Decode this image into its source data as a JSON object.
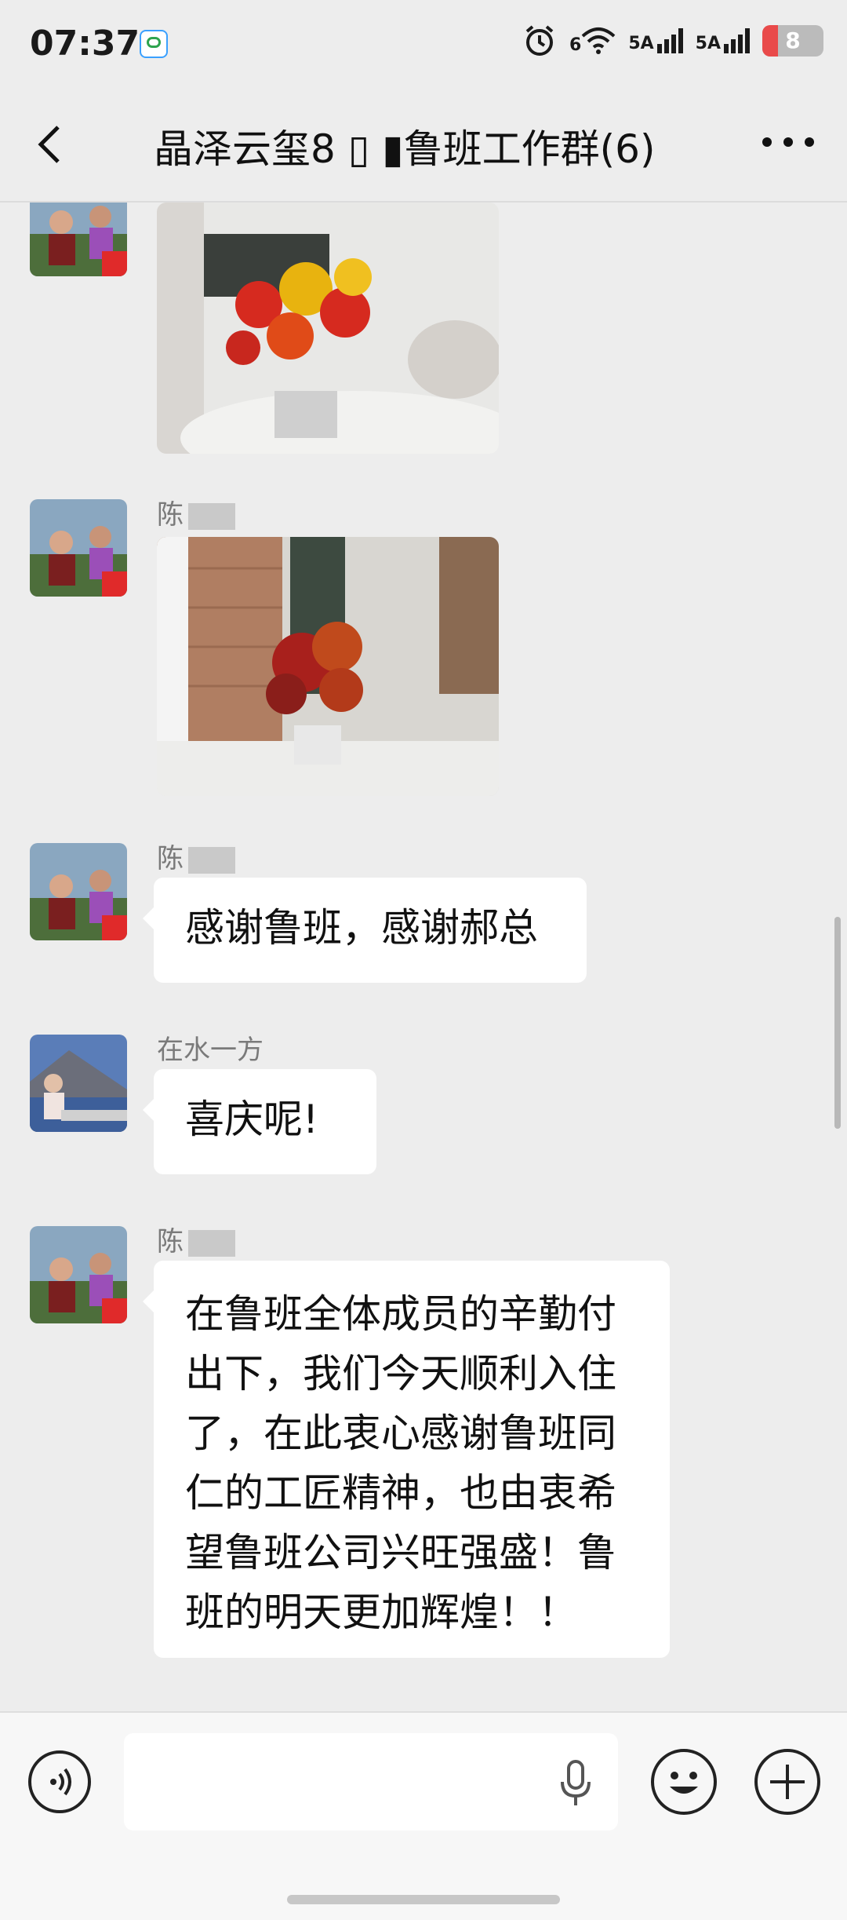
{
  "status_bar": {
    "time": "07:37",
    "signal1": "6",
    "signal2": "5A",
    "signal3": "5A",
    "battery": "8",
    "icons": [
      "app-notification-icon",
      "alarm-icon",
      "wifi-icon",
      "signal-icon",
      "signal-icon",
      "battery-icon"
    ]
  },
  "header": {
    "title": "晶泽云玺8 ▯ ▮鲁班工作群(6)",
    "back_icon": "chevron-left-icon",
    "more_icon": "more-dots-icon"
  },
  "messages": [
    {
      "type": "image",
      "sender": "",
      "image_desc_icon": "photo-flowers-vase-icon"
    },
    {
      "type": "image",
      "sender": "陈",
      "image_desc_icon": "photo-flowers-window-icon"
    },
    {
      "type": "text",
      "sender": "陈",
      "text": "感谢鲁班，感谢郝总"
    },
    {
      "type": "text",
      "sender": "在水一方",
      "text": "喜庆呢!"
    },
    {
      "type": "text",
      "sender": "陈",
      "text": "在鲁班全体成员的辛勤付出下，我们今天顺利入住了，在此衷心感谢鲁班同仁的工匠精神，也由衷希望鲁班公司兴旺强盛！鲁班的明天更加辉煌！！"
    }
  ],
  "input_bar": {
    "voice_icon": "voice-mode-icon",
    "mic_icon": "microphone-icon",
    "emoji_icon": "emoji-icon",
    "plus_icon": "plus-icon"
  },
  "colors": {
    "background": "#ededed",
    "bubble": "#ffffff",
    "battery_low": "#e94a4a"
  }
}
